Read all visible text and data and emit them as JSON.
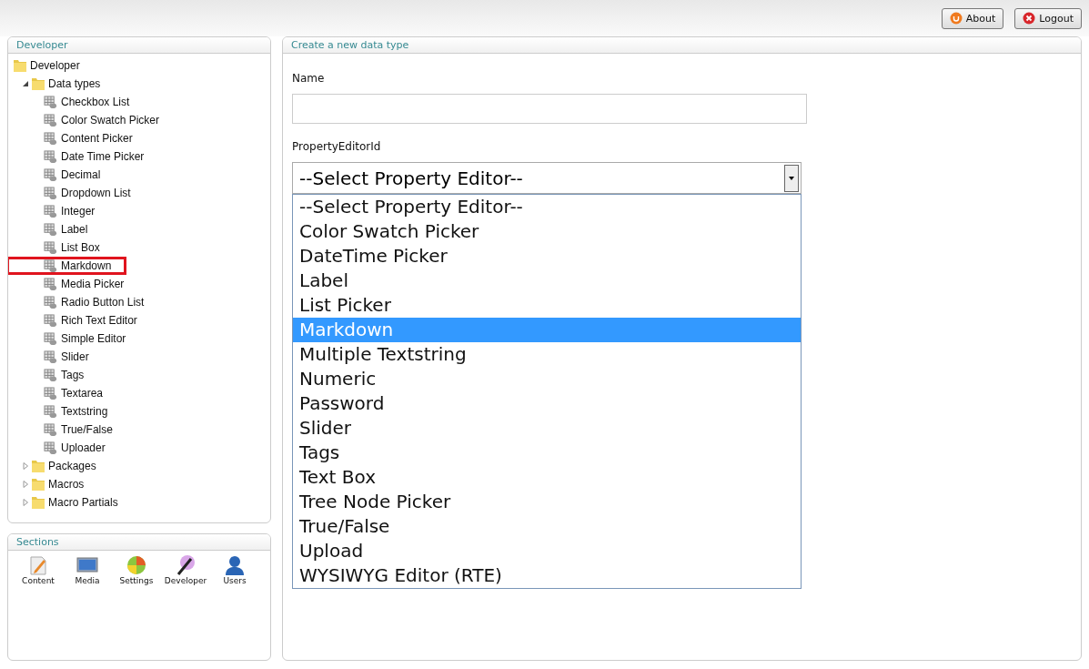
{
  "header": {
    "buttons": [
      {
        "label": "About",
        "kind": "about"
      },
      {
        "label": "Logout",
        "kind": "logout"
      }
    ]
  },
  "tree_panel": {
    "title": "Developer",
    "tree": [
      {
        "label": "Developer",
        "children": [
          {
            "label": "Data types",
            "expanded": true,
            "children": [
              {
                "label": "Checkbox List",
                "selected": false
              },
              {
                "label": "Color Swatch Picker",
                "selected": false
              },
              {
                "label": "Content Picker",
                "selected": false
              },
              {
                "label": "Date Time Picker",
                "selected": false
              },
              {
                "label": "Decimal",
                "selected": false
              },
              {
                "label": "Dropdown List",
                "selected": false
              },
              {
                "label": "Integer",
                "selected": false
              },
              {
                "label": "Label",
                "selected": false
              },
              {
                "label": "List Box",
                "selected": false
              },
              {
                "label": "Markdown",
                "selected": true
              },
              {
                "label": "Media Picker",
                "selected": false
              },
              {
                "label": "Radio Button List",
                "selected": false
              },
              {
                "label": "Rich Text Editor",
                "selected": false
              },
              {
                "label": "Simple Editor",
                "selected": false
              },
              {
                "label": "Slider",
                "selected": false
              },
              {
                "label": "Tags",
                "selected": false
              },
              {
                "label": "Textarea",
                "selected": false
              },
              {
                "label": "Textstring",
                "selected": false
              },
              {
                "label": "True/False",
                "selected": false
              },
              {
                "label": "Uploader",
                "selected": false
              }
            ]
          },
          {
            "label": "Packages",
            "expanded": false
          },
          {
            "label": "Macros",
            "expanded": false
          },
          {
            "label": "Macro Partials",
            "expanded": false
          }
        ]
      }
    ]
  },
  "sections_panel": {
    "title": "Sections",
    "items": [
      {
        "label": "Content",
        "kind": "content"
      },
      {
        "label": "Media",
        "kind": "media"
      },
      {
        "label": "Settings",
        "kind": "settings"
      },
      {
        "label": "Developer",
        "kind": "developer"
      },
      {
        "label": "Users",
        "kind": "users"
      }
    ]
  },
  "form_panel": {
    "title": "Create a new data type",
    "name_label": "Name",
    "editor_label": "PropertyEditorId",
    "editor_select": {
      "value": "--Select Property Editor--",
      "options": [
        {
          "label": "--Select Property Editor--",
          "highlighted": false
        },
        {
          "label": "Color Swatch Picker",
          "highlighted": false
        },
        {
          "label": "DateTime Picker",
          "highlighted": false
        },
        {
          "label": "Label",
          "highlighted": false
        },
        {
          "label": "List Picker",
          "highlighted": false
        },
        {
          "label": "Markdown",
          "highlighted": true
        },
        {
          "label": "Multiple Textstring",
          "highlighted": false
        },
        {
          "label": "Numeric",
          "highlighted": false
        },
        {
          "label": "Password",
          "highlighted": false
        },
        {
          "label": "Slider",
          "highlighted": false
        },
        {
          "label": "Tags",
          "highlighted": false
        },
        {
          "label": "Text Box",
          "highlighted": false
        },
        {
          "label": "Tree Node Picker",
          "highlighted": false
        },
        {
          "label": "True/False",
          "highlighted": false
        },
        {
          "label": "Upload",
          "highlighted": false
        },
        {
          "label": "WYSIWYG Editor (RTE)",
          "highlighted": false
        }
      ]
    }
  }
}
